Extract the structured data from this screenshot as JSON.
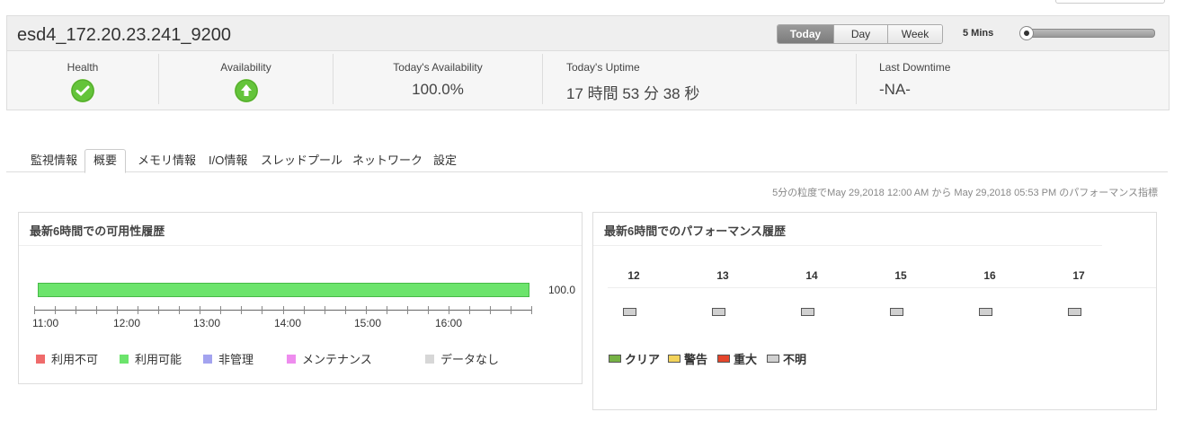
{
  "header": {
    "host": "esd4_172.20.23.241_9200",
    "range_buttons": [
      "Today",
      "Day",
      "Week"
    ],
    "active_range": "Today",
    "interval_label": "5 Mins"
  },
  "metrics": {
    "health_label": "Health",
    "health_status": "check",
    "availability_label": "Availability",
    "availability_status": "up",
    "today_availability_label": "Today's Availability",
    "today_availability_value": "100.0%",
    "uptime_label": "Today's Uptime",
    "uptime_value": "17 時間 53 分 38 秒",
    "downtime_label": "Last Downtime",
    "downtime_value": "-NA-"
  },
  "tabs": [
    "監視情報",
    "概要",
    "メモリ情報",
    "I/O情報",
    "スレッドプール",
    "ネットワーク",
    "設定"
  ],
  "active_tab": "概要",
  "range_note": "5分の粒度でMay 29,2018 12:00 AM から May 29,2018 05:53 PM のパフォーマンス指標",
  "availability_card": {
    "title": "最新6時間での可用性履歴",
    "bar_value_label": "100.0",
    "legend": [
      {
        "label": "利用不可",
        "color": "#ef6b6b"
      },
      {
        "label": "利用可能",
        "color": "#6ce46c"
      },
      {
        "label": "非管理",
        "color": "#a3a3ef"
      },
      {
        "label": "メンテナンス",
        "color": "#ee8cee"
      },
      {
        "label": "データなし",
        "color": "#d7d7d7"
      }
    ]
  },
  "performance_card": {
    "title": "最新6時間でのパフォーマンス履歴",
    "hours": [
      "12",
      "13",
      "14",
      "15",
      "16",
      "17"
    ],
    "legend": [
      {
        "label": "クリア",
        "color": "#76b245"
      },
      {
        "label": "警告",
        "color": "#f3d35a"
      },
      {
        "label": "重大",
        "color": "#e5452b"
      },
      {
        "label": "不明",
        "color": "#d0d0d0"
      }
    ]
  },
  "chart_data": {
    "type": "bar",
    "title": "最新6時間での可用性履歴",
    "x_ticks": [
      "11:00",
      "12:00",
      "13:00",
      "14:00",
      "15:00",
      "16:00"
    ],
    "series": [
      {
        "name": "利用可能",
        "values": [
          100.0
        ]
      }
    ],
    "ylim": [
      0,
      100
    ],
    "grid": false,
    "legend_placement": "bottom"
  }
}
